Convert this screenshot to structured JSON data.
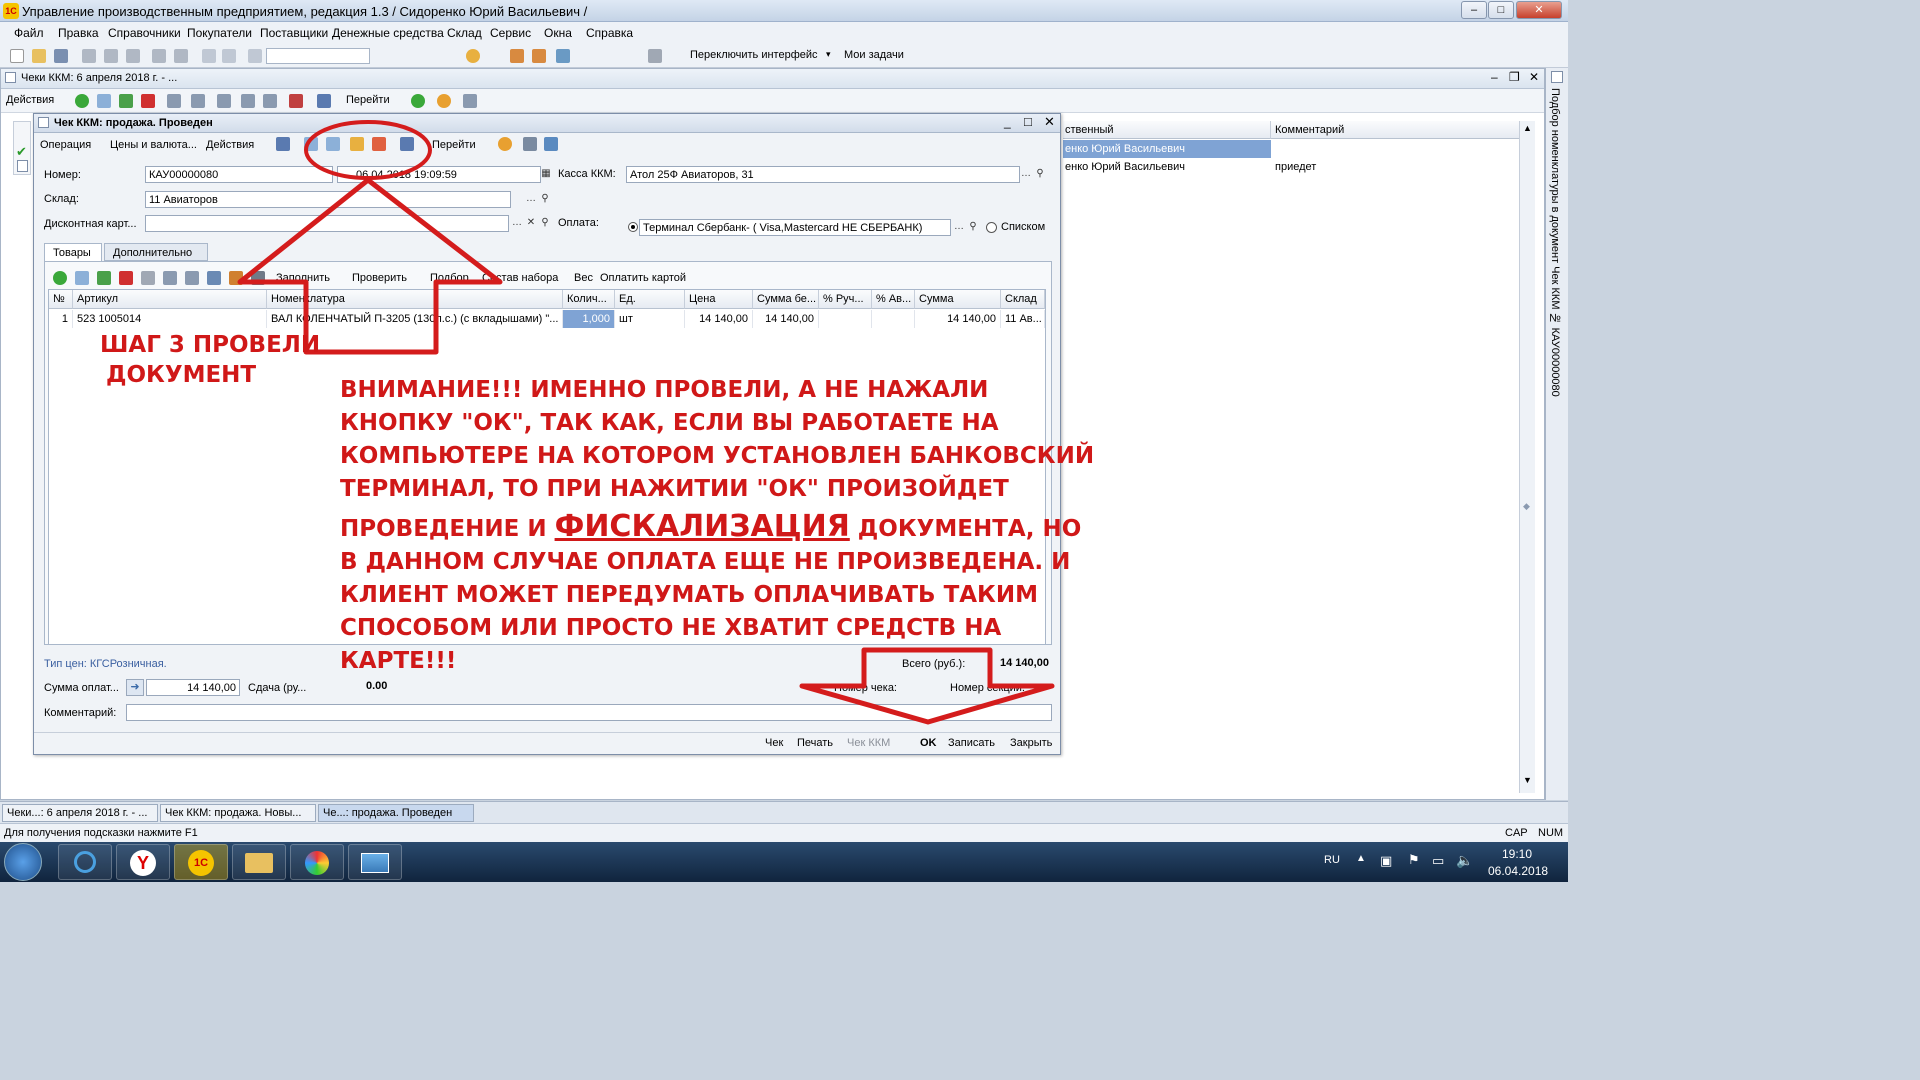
{
  "app": {
    "title": "Управление производственным предприятием, редакция 1.3 / Сидоренко Юрий Васильевич /"
  },
  "menu": [
    "Файл",
    "Правка",
    "Справочники",
    "Покупатели",
    "Поставщики",
    "Денежные средства",
    "Склад",
    "Сервис",
    "Окна",
    "Справка"
  ],
  "toolbar": {
    "switch_interface": "Переключить интерфейс",
    "my_tasks": "Мои задачи"
  },
  "bg_window": {
    "title": "Чеки ККМ: 6 апреля 2018 г. - ...",
    "actions": "Действия",
    "goto": "Перейти",
    "columns": [
      "ственный",
      "Комментарий"
    ],
    "rows": [
      [
        "енко Юрий Васильевич",
        ""
      ],
      [
        "енко Юрий Васильевич",
        "приедет"
      ]
    ]
  },
  "right_panel": {
    "label": "Подбор номенклатуры в документ Чек ККМ № КАУ00000080"
  },
  "dialog": {
    "title": "Чек ККМ: продажа. Проведен",
    "toolbar": [
      "Операция",
      "Цены и валюта...",
      "Действия",
      "Перейти"
    ],
    "number_label": "Номер:",
    "number": "КАУ00000080",
    "date": "06.04.2018 19:09:59",
    "kassa_label": "Касса ККМ:",
    "kassa": "Атол 25Ф Авиаторов, 31",
    "sklad_label": "Склад:",
    "sklad": "11 Авиаторов",
    "discount_label": "Дисконтная карт...",
    "discount": "",
    "payment_label": "Оплата:",
    "payment": "Терминал Сбербанк- ( Visa,Mastercard НЕ СБЕРБАНК)",
    "list_label": "Списком",
    "tabs": [
      "Товары",
      "Дополнительно"
    ],
    "goods_toolbar": [
      "Заполнить",
      "Проверить",
      "Подбор",
      "Состав набора",
      "Вес",
      "Оплатить картой"
    ],
    "columns": [
      "№",
      "Артикул",
      "Номенклатура",
      "Колич...",
      "Ед.",
      "Цена",
      "Сумма бе...",
      "% Руч...",
      "% Ав...",
      "Сумма",
      "Склад"
    ],
    "rows": [
      [
        "1",
        "523 1005014",
        "ВАЛ КОЛЕНЧАТЫЙ П-3205 (130л.с.) (с вкладышами) \"...",
        "1,000",
        "шт",
        "14 140,00",
        "14 140,00",
        "",
        "",
        "14 140,00",
        "11 Ав..."
      ]
    ],
    "price_type": "Тип цен: КГСРозничная.",
    "total_label": "Всего (руб.):",
    "total": "14 140,00",
    "pay_sum_label": "Сумма оплат...",
    "pay_sum": "14 140,00",
    "change_label": "Сдача (ру...",
    "change": "0.00",
    "check_number_label": "Номер чека:",
    "section_label": "Номер секции:",
    "comment_label": "Комментарий:",
    "comment": "",
    "bottom_buttons": [
      "Чек",
      "Печать",
      "Чек ККМ",
      "OK",
      "Записать",
      "Закрыть"
    ]
  },
  "annotations": {
    "step": [
      "ШАГ 3 ПРОВЕЛИ",
      "ДОКУМЕНТ"
    ],
    "warning": [
      "ВНИМАНИЕ!!! ИМЕННО ПРОВЕЛИ, А НЕ НАЖАЛИ",
      "КНОПКУ \"ОК\", ТАК КАК, ЕСЛИ ВЫ РАБОТАЕТЕ НА",
      "КОМПЬЮТЕРЕ НА КОТОРОМ УСТАНОВЛЕН БАНКОВСКИЙ",
      "ТЕРМИНАЛ, ТО ПРИ НАЖИТИИ \"ОК\" ПРОИЗОЙДЕТ"
    ],
    "warning_mid_pre": "ПРОВЕДЕНИЕ И ",
    "warning_mid_em": "ФИСКАЛИЗАЦИЯ",
    "warning_mid_post": " ДОКУМЕНТА, НО",
    "warning_tail": [
      "В ДАННОМ СЛУЧАЕ ОПЛАТА ЕЩЕ НЕ ПРОИЗВЕДЕНА. И",
      "КЛИЕНТ МОЖЕТ ПЕРЕДУМАТЬ ОПЛАЧИВАТЬ ТАКИМ",
      "СПОСОБОМ ИЛИ ПРОСТО НЕ ХВАТИТ СРЕДСТВ НА",
      "КАРТЕ!!!"
    ]
  },
  "taskbar_windows": [
    "Чеки...: 6 апреля 2018 г. - ...",
    "Чек ККМ: продажа. Новы...",
    "Че...: продажа. Проведен"
  ],
  "status": {
    "hint": "Для получения подсказки нажмите F1",
    "cap": "CAP",
    "num": "NUM"
  },
  "os_taskbar": {
    "lang": "RU",
    "time": "19:10",
    "date": "06.04.2018"
  }
}
